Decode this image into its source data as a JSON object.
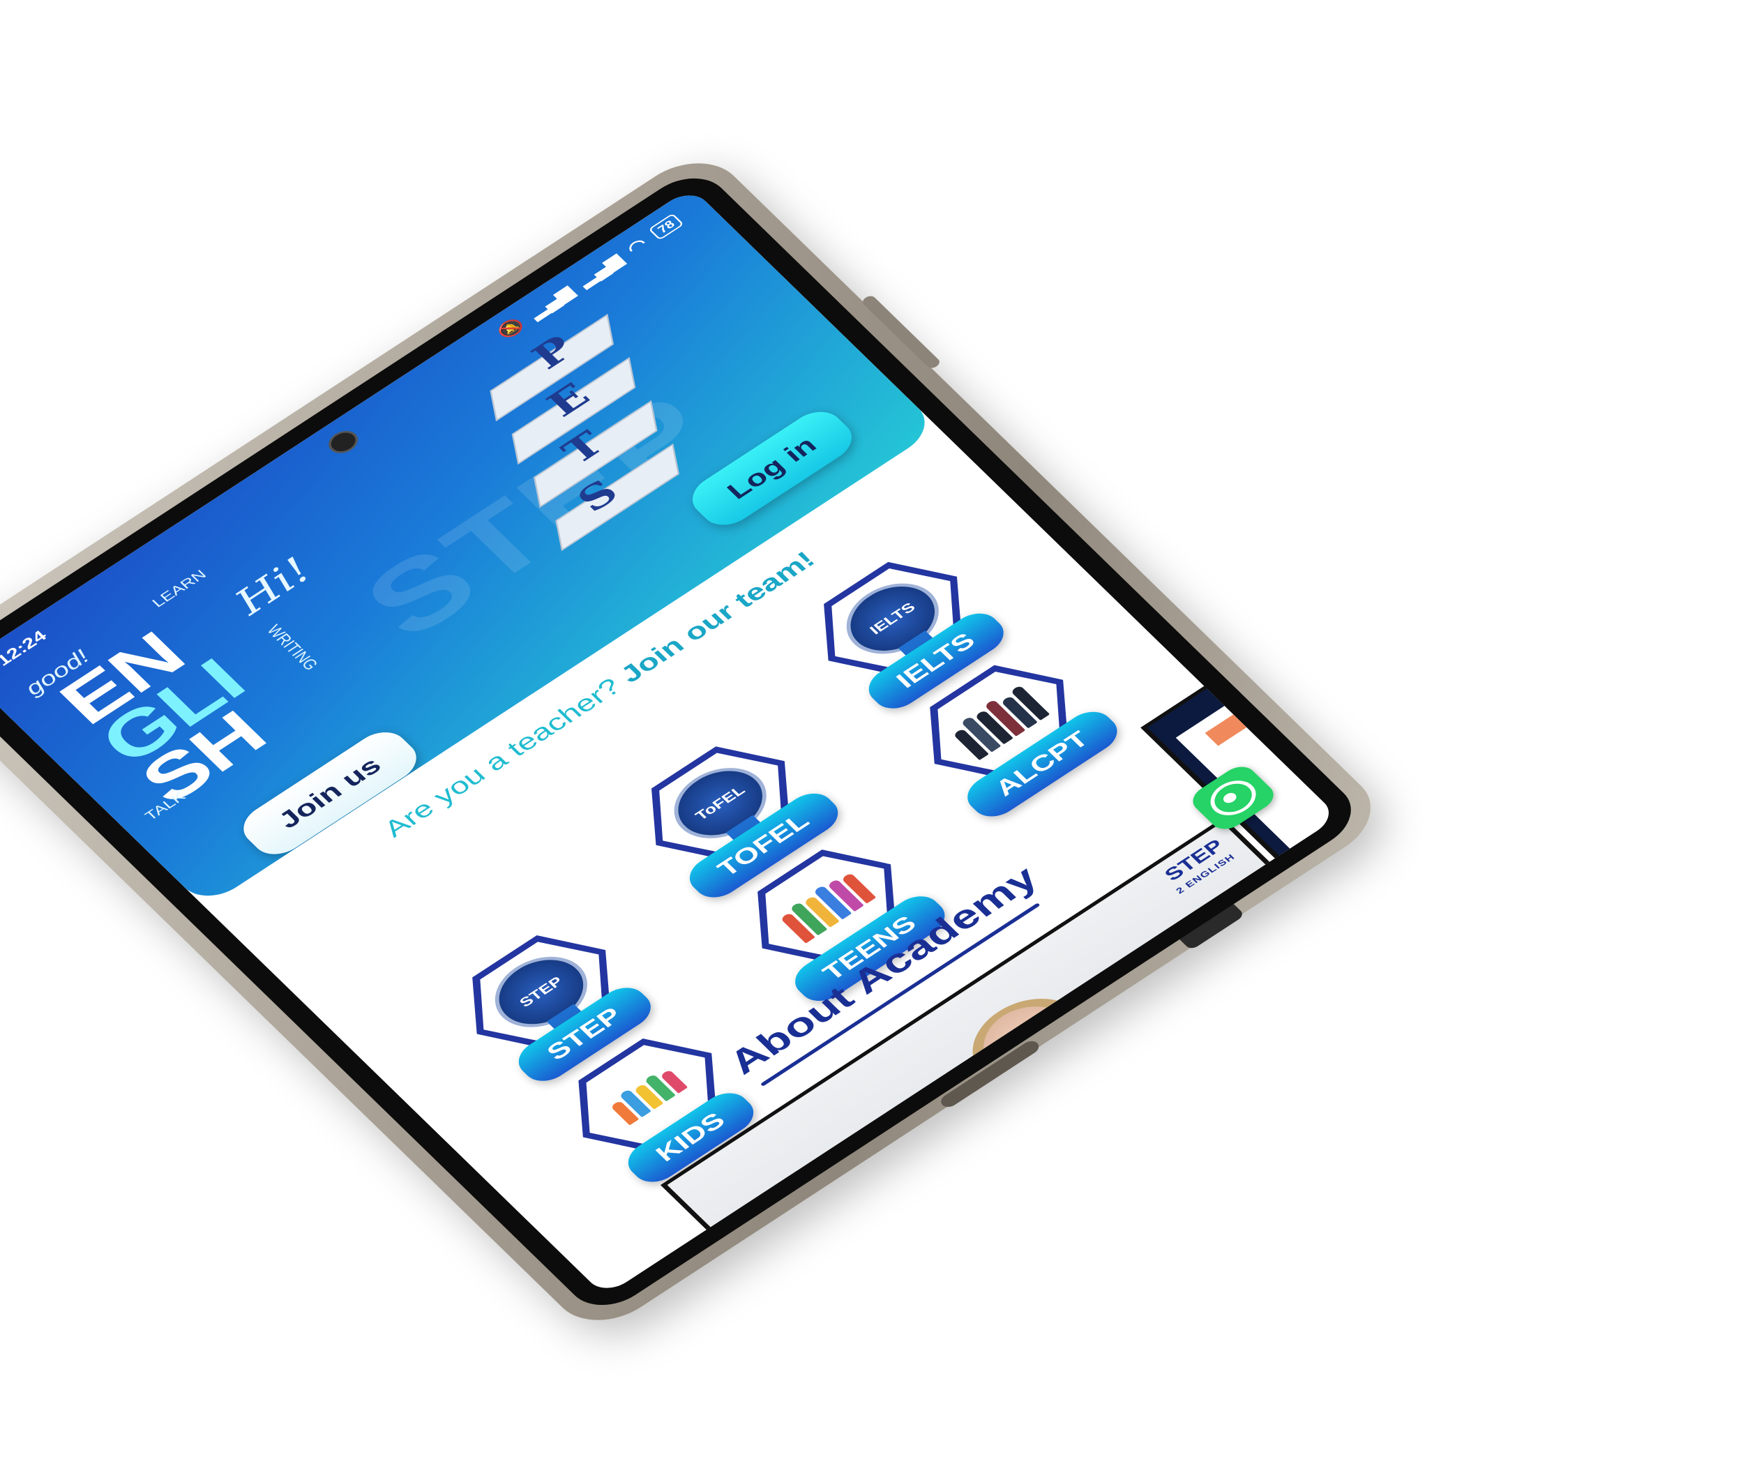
{
  "status_bar": {
    "time": "12:24",
    "battery": "78",
    "icons": [
      "mute-icon",
      "signal-icon",
      "signal-icon",
      "wifi-icon",
      "battery-icon"
    ]
  },
  "hero": {
    "english_lines": [
      "EN",
      "GLI",
      "SH"
    ],
    "english_words": [
      "good!",
      "LEARN",
      "TALK",
      "WRITING"
    ],
    "hi": "Hi!",
    "logo_letters": [
      "S",
      "T",
      "E",
      "P"
    ],
    "watermark": "STEP",
    "login_label": "Log in",
    "join_label": "Join us",
    "colors": {
      "gradient_start": "#1b4ec7",
      "gradient_end": "#25c6d6"
    }
  },
  "teacher_prompt": {
    "question": "Are you a teacher?",
    "link": "Join our team!"
  },
  "courses": [
    {
      "label": "IELTS",
      "badge_text": "IELTS",
      "icon": "ielts-medal-icon"
    },
    {
      "label": "TOFEL",
      "badge_text": "ToFEL",
      "icon": "tofel-medal-icon"
    },
    {
      "label": "ALCPT",
      "icon": "professionals-group-icon"
    },
    {
      "label": "STEP",
      "badge_text": "STEP",
      "icon": "step-medal-icon"
    },
    {
      "label": "TEENS",
      "icon": "teens-group-icon"
    },
    {
      "label": "KIDS",
      "icon": "kids-group-icon"
    }
  ],
  "about": {
    "title": "About Academy",
    "video_logo_main": "STEP",
    "video_logo_sub": "2 ENGLISH"
  },
  "whatsapp": {
    "icon": "whatsapp-icon",
    "color": "#25d366"
  }
}
